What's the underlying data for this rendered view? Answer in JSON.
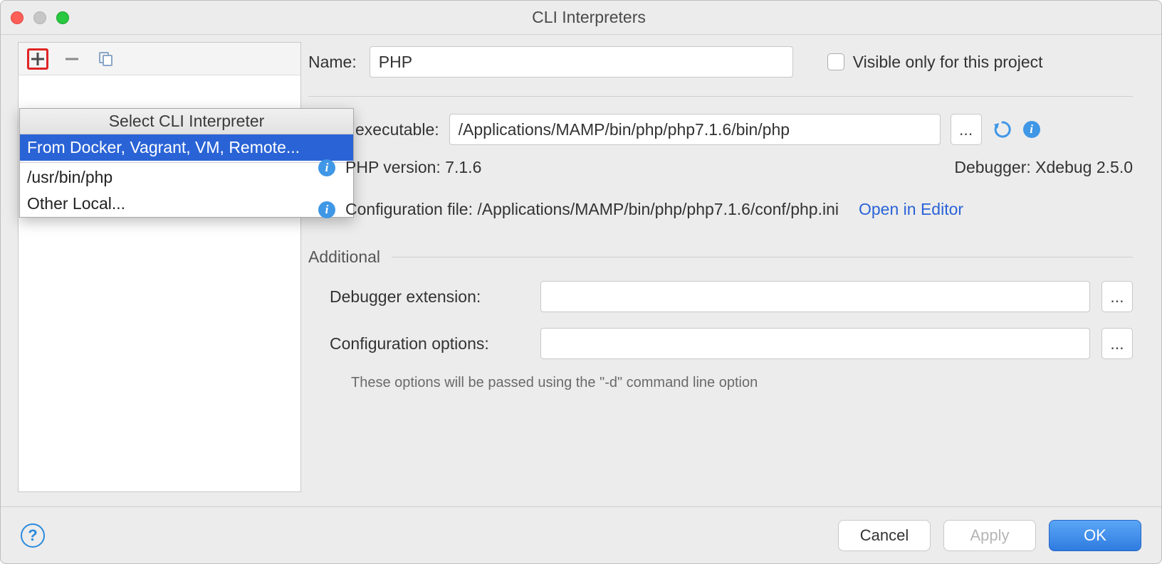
{
  "window": {
    "title": "CLI Interpreters"
  },
  "popup": {
    "title": "Select CLI Interpreter",
    "items": {
      "docker": "From Docker, Vagrant, VM, Remote...",
      "local_default": "/usr/bin/php",
      "other_local": "Other Local..."
    }
  },
  "form": {
    "name_label": "Name:",
    "name_value": "PHP",
    "visible_checkbox": "Visible only for this project",
    "executable_label_suffix": "executable:",
    "executable_path": "/Applications/MAMP/bin/php/php7.1.6/bin/php",
    "browse": "...",
    "php_version_label": "PHP version:",
    "php_version_value": "7.1.6",
    "debugger_label": "Debugger:",
    "debugger_value": "Xdebug 2.5.0",
    "config_label": "Configuration file:",
    "config_value": "/Applications/MAMP/bin/php/php7.1.6/conf/php.ini",
    "open_editor": "Open in Editor",
    "additional_section": "Additional",
    "debugger_ext_label": "Debugger extension:",
    "debugger_ext_value": "",
    "config_opts_label": "Configuration options:",
    "config_opts_value": "",
    "hint": "These options will be passed using the \"-d\" command line option"
  },
  "buttons": {
    "cancel": "Cancel",
    "apply": "Apply",
    "ok": "OK"
  }
}
